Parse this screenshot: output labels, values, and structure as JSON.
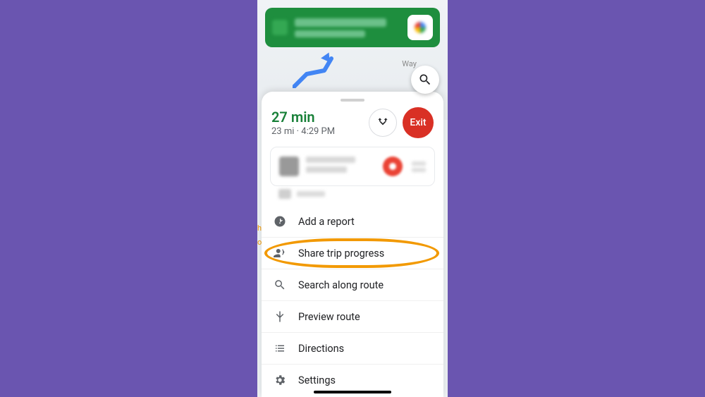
{
  "map": {
    "visible_road_label": "Way"
  },
  "trip": {
    "eta_label": "27 min",
    "distance_label": "23 mi",
    "separator": " · ",
    "arrival_label": "4:29 PM",
    "exit_label": "Exit"
  },
  "menu": {
    "items": [
      {
        "id": "add-report",
        "label": "Add a report",
        "icon": "report"
      },
      {
        "id": "share-trip",
        "label": "Share trip progress",
        "icon": "share",
        "highlighted": true
      },
      {
        "id": "search-route",
        "label": "Search along route",
        "icon": "search"
      },
      {
        "id": "preview-route",
        "label": "Preview route",
        "icon": "fork"
      },
      {
        "id": "directions",
        "label": "Directions",
        "icon": "list"
      },
      {
        "id": "settings",
        "label": "Settings",
        "icon": "gear"
      }
    ]
  }
}
